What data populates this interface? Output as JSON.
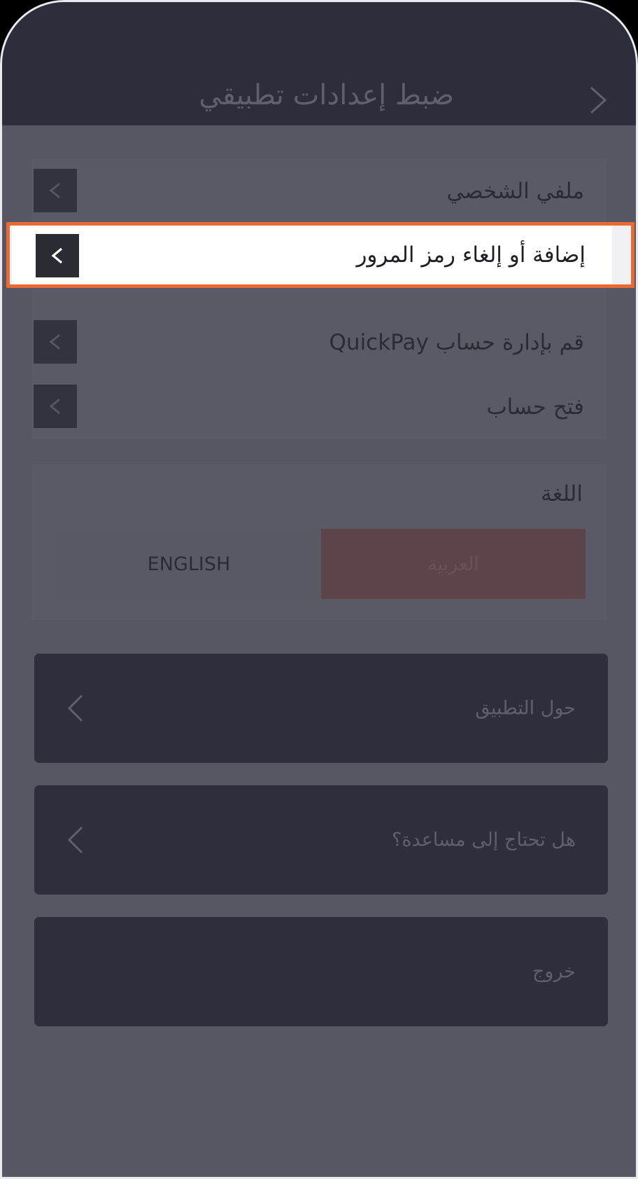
{
  "header": {
    "title": "ضبط إعدادات تطبيقي"
  },
  "menu": {
    "items": [
      {
        "label": "ملفي الشخصي"
      },
      {
        "label": "إضافة أو إلغاء رمز المرور"
      },
      {
        "label": "قم  بإدارة حساب QuickPay"
      },
      {
        "label": "فتح حساب"
      }
    ]
  },
  "language": {
    "title": "اللغة",
    "options": [
      "ENGLISH",
      "العربية"
    ],
    "selected": "العربية"
  },
  "actions": [
    {
      "label": "حول التطبيق"
    },
    {
      "label": "هل تحتاج إلى مساعدة؟"
    },
    {
      "label": "خروج"
    }
  ],
  "colors": {
    "accent_highlight": "#ea6a35",
    "header_bg": "#2d2d3b",
    "selected_language_bg": "#5c4448"
  }
}
